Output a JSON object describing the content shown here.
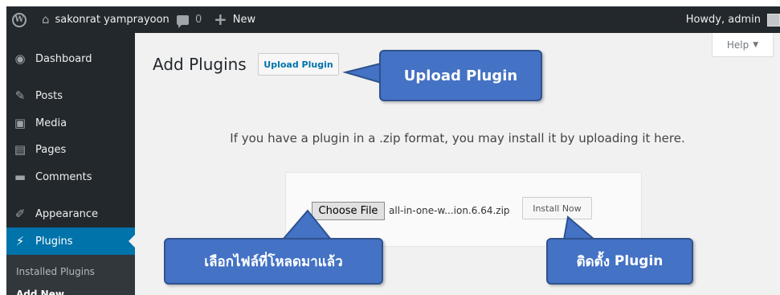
{
  "admin_bar": {
    "site_name": "sakonrat yamprayoon",
    "comment_count": "0",
    "new_label": "New",
    "howdy": "Howdy, admin"
  },
  "sidebar": {
    "items": [
      {
        "label": "Dashboard",
        "icon": "dashboard-icon"
      },
      {
        "label": "Posts",
        "icon": "pushpin-icon"
      },
      {
        "label": "Media",
        "icon": "media-icon"
      },
      {
        "label": "Pages",
        "icon": "pages-icon"
      },
      {
        "label": "Comments",
        "icon": "comment-icon"
      },
      {
        "label": "Appearance",
        "icon": "brush-icon"
      },
      {
        "label": "Plugins",
        "icon": "plug-icon",
        "active": true
      }
    ],
    "submenu": {
      "installed": "Installed Plugins",
      "add_new": "Add New"
    }
  },
  "main": {
    "title": "Add Plugins",
    "upload_button": "Upload Plugin",
    "help_tab": "Help",
    "upload_info": "If you have a plugin in a .zip format, you may install it by uploading it here.",
    "choose_file": "Choose File",
    "file_name": "all-in-one-w...ion.6.64.zip",
    "install_button": "Install Now"
  },
  "callouts": {
    "upload": "Upload Plugin",
    "file_selected": "เลือกไฟล์ที่โหลดมาแล้ว",
    "install_prefix": "ติดตั้ง",
    "install_word": "Plugin"
  },
  "colors": {
    "admin_bar": "#23282d",
    "active_menu": "#0073aa",
    "callout_fill": "#4472c4",
    "callout_border": "#2f528f"
  }
}
